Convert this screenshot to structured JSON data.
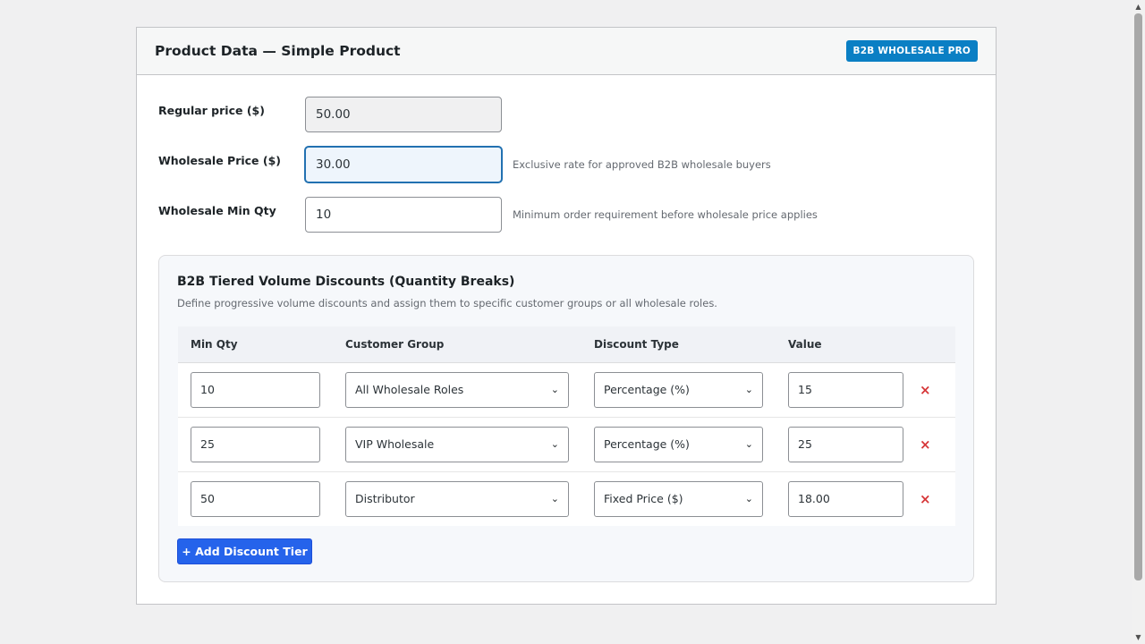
{
  "header": {
    "title": "Product Data — Simple Product",
    "badge": "B2B WHOLESALE PRO"
  },
  "fields": {
    "regular_price": {
      "label": "Regular price ($)",
      "value": "50.00"
    },
    "wholesale_price": {
      "label": "Wholesale Price ($)",
      "value": "30.00",
      "description": "Exclusive rate for approved B2B wholesale buyers"
    },
    "wholesale_min_qty": {
      "label": "Wholesale Min Qty",
      "value": "10",
      "description": "Minimum order requirement before wholesale price applies"
    }
  },
  "tiers": {
    "title": "B2B Tiered Volume Discounts (Quantity Breaks)",
    "description": "Define progressive volume discounts and assign them to specific customer groups or all wholesale roles.",
    "columns": [
      "Min Qty",
      "Customer Group",
      "Discount Type",
      "Value"
    ],
    "rows": [
      {
        "min_qty": "10",
        "group": "All Wholesale Roles",
        "type": "Percentage (%)",
        "value": "15"
      },
      {
        "min_qty": "25",
        "group": "VIP Wholesale",
        "type": "Percentage (%)",
        "value": "25"
      },
      {
        "min_qty": "50",
        "group": "Distributor",
        "type": "Fixed Price ($)",
        "value": "18.00"
      }
    ],
    "remove_glyph": "×",
    "add_label": "+ Add Discount Tier"
  },
  "icons": {
    "chevron": "⌄",
    "scroll_up": "▲",
    "scroll_down": "▼"
  },
  "colors": {
    "badge": "#0a7fc4",
    "add_button": "#2563eb",
    "remove": "#d63638",
    "focus": "#2271b1"
  }
}
